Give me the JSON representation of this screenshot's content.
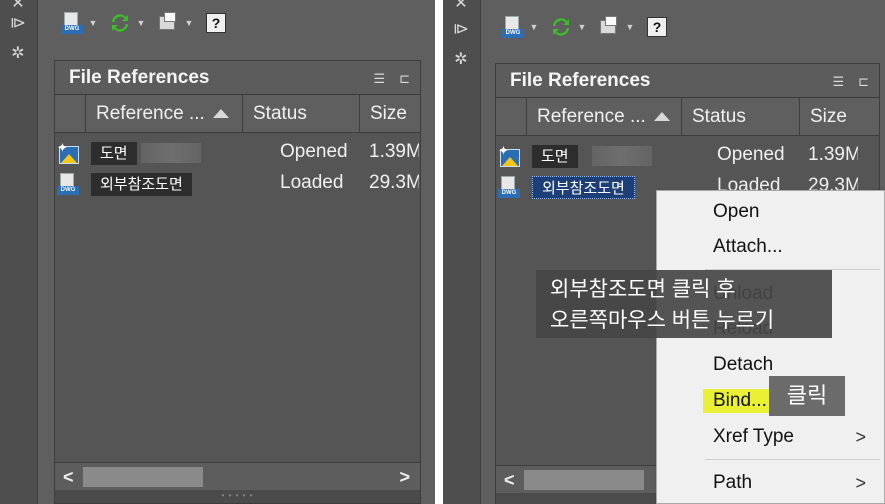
{
  "panel": {
    "title": "File References",
    "columns": {
      "reference": "Reference ...",
      "status": "Status",
      "size": "Size"
    },
    "rows": [
      {
        "name": "도면",
        "status": "Opened",
        "size": "1.39M",
        "icon": "drawing-star-icon"
      },
      {
        "name": "외부참조도면",
        "status": "Loaded",
        "size": "29.3M",
        "icon": "dwg-file-icon"
      }
    ],
    "scroll_left": "<",
    "scroll_right": ">"
  },
  "toolbar": {
    "dwg": "DWG",
    "help": "?"
  },
  "context_menu": {
    "items": [
      "Open",
      "Attach...",
      "Unload",
      "Reload",
      "Detach",
      "Bind...",
      "Xref Type",
      "Path"
    ],
    "submenu_arrow": ">"
  },
  "annotation": {
    "callout_line1": "외부참조도면 클릭 후",
    "callout_line2": "오른쪽마우스 버튼 누르기",
    "click_label": "클릭",
    "highlight_color": "#e8f020"
  },
  "colors": {
    "panel_bg": "#5f5f5f",
    "selection": "#1d3f78",
    "menu_bg": "#f0f0f0"
  }
}
